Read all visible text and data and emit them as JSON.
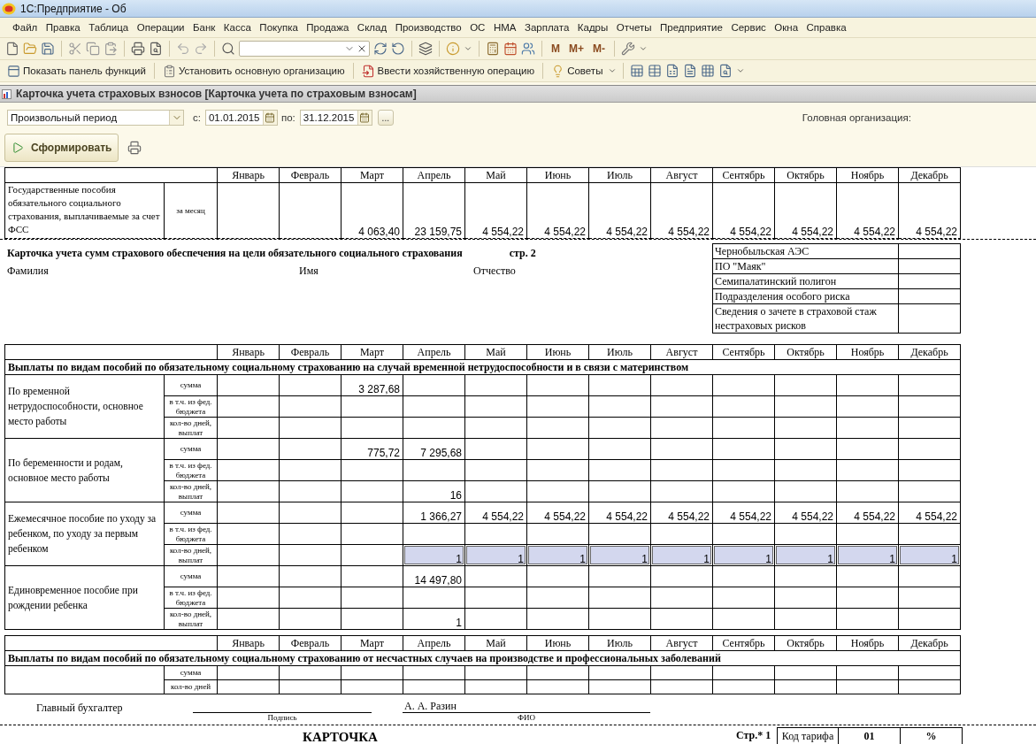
{
  "window": {
    "title": "1С:Предприятие - Об"
  },
  "menu": [
    "Файл",
    "Правка",
    "Таблица",
    "Операции",
    "Банк",
    "Касса",
    "Покупка",
    "Продажа",
    "Склад",
    "Производство",
    "ОС",
    "НМА",
    "Зарплата",
    "Кадры",
    "Отчеты",
    "Предприятие",
    "Сервис",
    "Окна",
    "Справка"
  ],
  "toolbar": {
    "memory_buttons": [
      "M",
      "M+",
      "M-"
    ]
  },
  "function_bar": [
    "Показать панель функций",
    "Установить основную организацию",
    "Ввести хозяйственную операцию",
    "Советы"
  ],
  "report": {
    "title": "Карточка учета страховых взносов [Карточка учета по страховым взносам]",
    "filter": {
      "period": "Произвольный период",
      "from_label": "с:",
      "from": "01.01.2015",
      "to_label": "по:",
      "to": "31.12.2015",
      "more": "...",
      "organization_label": "Головная организация:"
    },
    "generate_button": "Сформировать"
  },
  "sheet": {
    "state_benefits": {
      "months": [
        "Январь",
        "Февраль",
        "Март",
        "Апрель",
        "Май",
        "Июнь",
        "Июль",
        "Август",
        "Сентябрь",
        "Октябрь",
        "Ноябрь",
        "Декабрь"
      ],
      "label": "Государственные пособия обязательного социального страхования, выплачиваемые за счет ФСС",
      "sublabel": "за месяц",
      "cells": [
        {},
        {},
        {
          "value": "4 063,40"
        },
        {
          "value": "23 159,75"
        },
        {
          "value": "4 554,22"
        },
        {
          "value": "4 554,22"
        },
        {
          "value": "4 554,22"
        },
        {
          "value": "4 554,22"
        },
        {
          "value": "4 554,22"
        },
        {
          "value": "4 554,22"
        },
        {
          "value": "4 554,22"
        },
        {
          "value": "4 554,22"
        }
      ]
    },
    "card": {
      "heading": "Карточка учета сумм страхового обеспечения на цели обязательного социального страхования",
      "page": "стр. 2",
      "fields": [
        "Фамилия",
        "Имя",
        "Отчество"
      ],
      "risks": [
        "Чернобыльская АЭС",
        "ПО \"Маяк\"",
        "Семипалатинский полигон",
        "Подразделения особого риска",
        "Сведения о зачете в страховой стаж нестраховых рисков"
      ]
    },
    "temporary_disability": {
      "months": [
        "Январь",
        "Февраль",
        "Март",
        "Апрель",
        "Май",
        "Июнь",
        "Июль",
        "Август",
        "Сентябрь",
        "Октябрь",
        "Ноябрь",
        "Декабрь"
      ],
      "title": "Выплаты по видам пособий по обязательному социальному страхованию на случай временной нетрудоспособности и в связи с материнством",
      "groups": [
        {
          "label": "По временной нетрудоспособности, основное место работы",
          "rows": [
            {
              "label": "сумма",
              "selected": false,
              "cells": [
                {},
                {},
                {
                  "value": "3 287,68"
                },
                {},
                {},
                {},
                {},
                {},
                {},
                {},
                {},
                {}
              ]
            },
            {
              "label": "в т.ч. из фед. бюджета",
              "selected": false
            },
            {
              "label": "кол-во дней, выплат",
              "selected": false
            }
          ]
        },
        {
          "label": "По беременности и родам, основное место работы",
          "rows": [
            {
              "label": "сумма",
              "selected": false,
              "cells": [
                {},
                {},
                {
                  "value": "775,72"
                },
                {
                  "value": "7 295,68"
                },
                {},
                {},
                {},
                {},
                {},
                {},
                {},
                {}
              ]
            },
            {
              "label": "в т.ч. из фед. бюджета",
              "selected": false
            },
            {
              "label": "кол-во дней, выплат",
              "selected": false,
              "cells": [
                {},
                {},
                {},
                {
                  "value": "16"
                },
                {},
                {},
                {},
                {},
                {},
                {},
                {},
                {}
              ]
            }
          ]
        },
        {
          "label": "Ежемесячное пособие по уходу за ребенком, по уходу за первым ребенком",
          "rows": [
            {
              "label": "сумма",
              "selected": false,
              "cells": [
                {},
                {},
                {},
                {
                  "value": "1 366,27"
                },
                {
                  "value": "4 554,22"
                },
                {
                  "value": "4 554,22"
                },
                {
                  "value": "4 554,22"
                },
                {
                  "value": "4 554,22"
                },
                {
                  "value": "4 554,22"
                },
                {
                  "value": "4 554,22"
                },
                {
                  "value": "4 554,22"
                },
                {
                  "value": "4 554,22"
                }
              ]
            },
            {
              "label": "в т.ч. из фед. бюджета",
              "selected": false
            },
            {
              "label": "кол-во дней, выплат",
              "selected": true,
              "cells": [
                {},
                {},
                {},
                {
                  "value": "1"
                },
                {
                  "value": "1"
                },
                {
                  "value": "1"
                },
                {
                  "value": "1"
                },
                {
                  "value": "1"
                },
                {
                  "value": "1"
                },
                {
                  "value": "1"
                },
                {
                  "value": "1"
                },
                {
                  "value": "1"
                }
              ]
            }
          ]
        },
        {
          "label": "Единовременное пособие при рождении ребенка",
          "rows": [
            {
              "label": "сумма",
              "selected": false,
              "cells": [
                {},
                {},
                {},
                {
                  "value": "14 497,80"
                },
                {},
                {},
                {},
                {},
                {},
                {},
                {},
                {}
              ]
            },
            {
              "label": "в т.ч. из фед. бюджета",
              "selected": false
            },
            {
              "label": "кол-во дней, выплат",
              "selected": false,
              "cells": [
                {},
                {},
                {},
                {
                  "value": "1"
                },
                {},
                {},
                {},
                {},
                {},
                {},
                {},
                {}
              ]
            }
          ]
        }
      ]
    },
    "accidents": {
      "months": [
        "Январь",
        "Февраль",
        "Март",
        "Апрель",
        "Май",
        "Июнь",
        "Июль",
        "Август",
        "Сентябрь",
        "Октябрь",
        "Ноябрь",
        "Декабрь"
      ],
      "title": "Выплаты по видам пособий по обязательному социальному страхованию от несчастных случаев на производстве и профессиональных заболеваний",
      "rows": [
        {
          "label": "сумма"
        },
        {
          "label": "кол-во дней"
        }
      ]
    },
    "signature": {
      "role": "Главный бухгалтер",
      "signature_caption": "Подпись",
      "name": "А. А. Разин",
      "name_caption": "ФИО"
    },
    "footer": {
      "title": "КАРТОЧКА",
      "page": "Стр.* 1",
      "tariff_label": "Код тарифа",
      "tariff_code": "01",
      "percent": "%"
    }
  }
}
